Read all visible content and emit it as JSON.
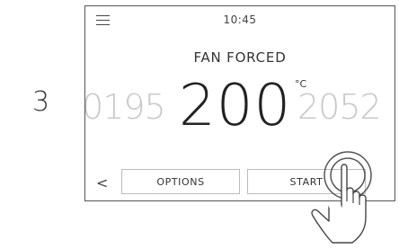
{
  "step": "3",
  "status_bar": {
    "time": "10:45"
  },
  "cooking": {
    "mode": "FAN FORCED",
    "temperature_prev": "0195",
    "temperature": "200",
    "temperature_next": "2052",
    "unit": "°C"
  },
  "actions": {
    "back_label": "<",
    "options_label": "OPTIONS",
    "start_label": "START"
  },
  "icons": {
    "menu": "menu-icon",
    "back": "chevron-left-icon",
    "hand": "pointing-hand-icon"
  }
}
